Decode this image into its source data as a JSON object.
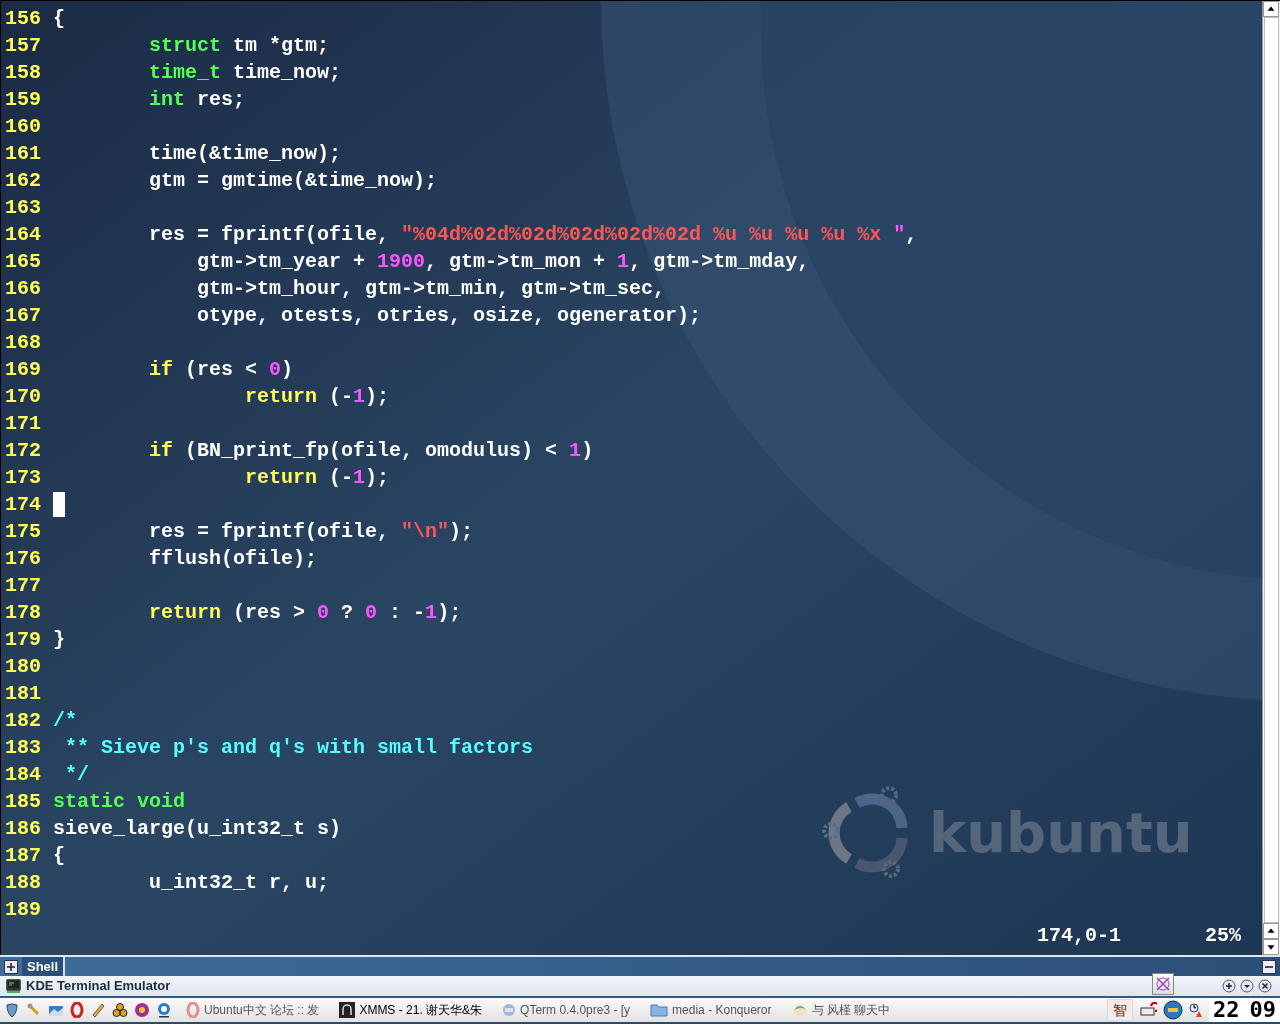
{
  "terminal": {
    "lines": [
      {
        "number": "156",
        "segments": [
          {
            "kind": "plain",
            "text": "{"
          }
        ]
      },
      {
        "number": "157",
        "segments": [
          {
            "kind": "type",
            "text": "        struct"
          },
          {
            "kind": "plain",
            "text": " tm *gtm;"
          }
        ]
      },
      {
        "number": "158",
        "segments": [
          {
            "kind": "type",
            "text": "        time_t"
          },
          {
            "kind": "plain",
            "text": " time_now;"
          }
        ]
      },
      {
        "number": "159",
        "segments": [
          {
            "kind": "type",
            "text": "        int"
          },
          {
            "kind": "plain",
            "text": " res;"
          }
        ]
      },
      {
        "number": "160"
      },
      {
        "number": "161",
        "segments": [
          {
            "kind": "plain",
            "text": "        time(&time_now);"
          }
        ]
      },
      {
        "number": "162",
        "segments": [
          {
            "kind": "plain",
            "text": "        gtm = gmtime(&time_now);"
          }
        ]
      },
      {
        "number": "163"
      },
      {
        "number": "164",
        "segments": [
          {
            "kind": "plain",
            "text": "        res = fprintf(ofile, "
          },
          {
            "kind": "string",
            "text": "\"%04d%02d%02d%02d%02d%02d %u %u %u %u %x "
          },
          {
            "kind": "number",
            "text": "\""
          },
          {
            "kind": "plain",
            "text": ","
          }
        ]
      },
      {
        "number": "165",
        "segments": [
          {
            "kind": "plain",
            "text": "            gtm->tm_year + "
          },
          {
            "kind": "number",
            "text": "1900"
          },
          {
            "kind": "plain",
            "text": ", gtm->tm_mon + "
          },
          {
            "kind": "number",
            "text": "1"
          },
          {
            "kind": "plain",
            "text": ", gtm->tm_mday,"
          }
        ]
      },
      {
        "number": "166",
        "segments": [
          {
            "kind": "plain",
            "text": "            gtm->tm_hour, gtm->tm_min, gtm->tm_sec,"
          }
        ]
      },
      {
        "number": "167",
        "segments": [
          {
            "kind": "plain",
            "text": "            otype, otests, otries, osize, ogenerator);"
          }
        ]
      },
      {
        "number": "168"
      },
      {
        "number": "169",
        "segments": [
          {
            "kind": "keyword",
            "text": "        if"
          },
          {
            "kind": "plain",
            "text": " (res < "
          },
          {
            "kind": "number",
            "text": "0"
          },
          {
            "kind": "plain",
            "text": ")"
          }
        ]
      },
      {
        "number": "170",
        "segments": [
          {
            "kind": "keyword",
            "text": "                return"
          },
          {
            "kind": "plain",
            "text": " (-"
          },
          {
            "kind": "number",
            "text": "1"
          },
          {
            "kind": "plain",
            "text": ");"
          }
        ]
      },
      {
        "number": "171"
      },
      {
        "number": "172",
        "segments": [
          {
            "kind": "keyword",
            "text": "        if"
          },
          {
            "kind": "plain",
            "text": " (BN_print_fp(ofile, omodulus) < "
          },
          {
            "kind": "number",
            "text": "1"
          },
          {
            "kind": "plain",
            "text": ")"
          }
        ]
      },
      {
        "number": "173",
        "segments": [
          {
            "kind": "keyword",
            "text": "                return"
          },
          {
            "kind": "plain",
            "text": " (-"
          },
          {
            "kind": "number",
            "text": "1"
          },
          {
            "kind": "plain",
            "text": ");"
          }
        ]
      },
      {
        "number": "174",
        "cursor": true
      },
      {
        "number": "175",
        "segments": [
          {
            "kind": "plain",
            "text": "        res = fprintf(ofile, "
          },
          {
            "kind": "string",
            "text": "\"\\n\""
          },
          {
            "kind": "plain",
            "text": ");"
          }
        ]
      },
      {
        "number": "176",
        "segments": [
          {
            "kind": "plain",
            "text": "        fflush(ofile);"
          }
        ]
      },
      {
        "number": "177"
      },
      {
        "number": "178",
        "segments": [
          {
            "kind": "keyword",
            "text": "        return"
          },
          {
            "kind": "plain",
            "text": " (res > "
          },
          {
            "kind": "number",
            "text": "0"
          },
          {
            "kind": "plain",
            "text": " ? "
          },
          {
            "kind": "number",
            "text": "0"
          },
          {
            "kind": "plain",
            "text": " : -"
          },
          {
            "kind": "number",
            "text": "1"
          },
          {
            "kind": "plain",
            "text": ");"
          }
        ]
      },
      {
        "number": "179",
        "segments": [
          {
            "kind": "plain",
            "text": "}"
          }
        ]
      },
      {
        "number": "180"
      },
      {
        "number": "181"
      },
      {
        "number": "182",
        "segments": [
          {
            "kind": "comment",
            "text": "/*"
          }
        ]
      },
      {
        "number": "183",
        "segments": [
          {
            "kind": "comment",
            "text": " ** Sieve p's and q's with small factors"
          }
        ]
      },
      {
        "number": "184",
        "segments": [
          {
            "kind": "comment",
            "text": " */"
          }
        ]
      },
      {
        "number": "185",
        "segments": [
          {
            "kind": "type",
            "text": "static void"
          }
        ]
      },
      {
        "number": "186",
        "segments": [
          {
            "kind": "plain",
            "text": "sieve_large(u_int32_t s)"
          }
        ]
      },
      {
        "number": "187",
        "segments": [
          {
            "kind": "plain",
            "text": "{"
          }
        ]
      },
      {
        "number": "188",
        "segments": [
          {
            "kind": "plain",
            "text": "        u_int32_t r, u;"
          }
        ]
      },
      {
        "number": "189"
      }
    ],
    "status_position": "174,0-1",
    "status_percent": "25%",
    "wallpaper_logo": "kubuntu"
  },
  "tabs": [
    {
      "label": "Shell",
      "selected": true
    }
  ],
  "window": {
    "title": "KDE Terminal Emulator"
  },
  "taskbar": {
    "tasks": [
      {
        "label": "Ubuntu中文 论坛 :: 发",
        "kind": "browser"
      },
      {
        "label": "XMMS - 21. 谢天华&朱",
        "kind": "player"
      },
      {
        "label": "QTerm 0.4.0pre3 - [y",
        "kind": "qterm"
      },
      {
        "label": "media - Konqueror",
        "kind": "folder"
      },
      {
        "label": "与 风槿 聊天中",
        "kind": "chat"
      }
    ],
    "tray_input": "智",
    "clock_hours": "22",
    "clock_minutes": "09"
  }
}
